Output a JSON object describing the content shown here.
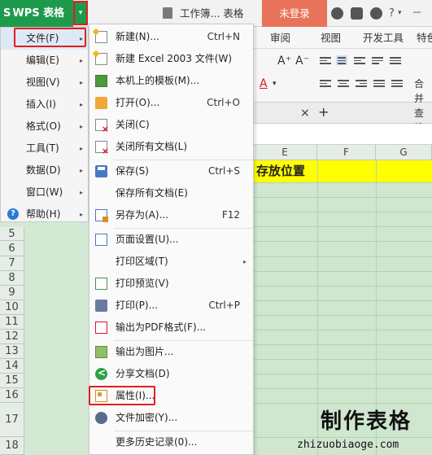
{
  "app": {
    "logo_text": "WPS 表格",
    "dropdown_glyph": "▾",
    "doc_title": "工作簿... 表格",
    "login_label": "未登录",
    "toolbar_glyphs": {
      "help": "?",
      "help_arrow": "▾",
      "minimize": "－"
    }
  },
  "ribbon": {
    "tabs": [
      "审阅",
      "视图",
      "开发工具",
      "特色"
    ],
    "font_grow": "A⁺",
    "font_shrink": "A⁻",
    "font_color_letter": "A",
    "font_color_arrow": "▾",
    "merge_label": "合并",
    "doc_tab_close": "×",
    "doc_tab_add": "+",
    "search_label": "查找"
  },
  "sheet": {
    "col_headers": [
      "E",
      "F",
      "G"
    ],
    "row_headers": [
      "5",
      "6",
      "7",
      "8",
      "9",
      "10",
      "11",
      "12",
      "13",
      "14",
      "15",
      "16",
      "17",
      "18"
    ],
    "yellow_cell_text": "存放位置"
  },
  "menu_level1": [
    {
      "label": "文件(F)",
      "arrow": "▸"
    },
    {
      "label": "编辑(E)",
      "arrow": "▸"
    },
    {
      "label": "视图(V)",
      "arrow": "▸"
    },
    {
      "label": "插入(I)",
      "arrow": "▸"
    },
    {
      "label": "格式(O)",
      "arrow": "▸"
    },
    {
      "label": "工具(T)",
      "arrow": "▸"
    },
    {
      "label": "数据(D)",
      "arrow": "▸"
    },
    {
      "label": "窗口(W)",
      "arrow": "▸"
    },
    {
      "label": "帮助(H)",
      "arrow": "▸",
      "icon_text": "?"
    }
  ],
  "menu_level2": [
    {
      "label": "新建(N)...",
      "shortcut": "Ctrl+N",
      "icon": "new-icon"
    },
    {
      "label": "新建 Excel 2003 文件(W)",
      "shortcut": "",
      "icon": "new-excel-icon"
    },
    {
      "label": "本机上的模板(M)...",
      "shortcut": "",
      "icon": "template-icon"
    },
    {
      "label": "打开(O)...",
      "shortcut": "Ctrl+O",
      "icon": "folder-open-icon"
    },
    {
      "label": "关闭(C)",
      "shortcut": "",
      "icon": "close-doc-icon"
    },
    {
      "label": "关闭所有文档(L)",
      "shortcut": "",
      "icon": "close-all-icon"
    },
    {
      "label": "保存(S)",
      "shortcut": "Ctrl+S",
      "icon": "save-icon"
    },
    {
      "label": "保存所有文档(E)",
      "shortcut": "",
      "icon": ""
    },
    {
      "label": "另存为(A)...",
      "shortcut": "F12",
      "icon": "save-as-icon"
    },
    {
      "label": "页面设置(U)...",
      "shortcut": "",
      "icon": "page-setup-icon"
    },
    {
      "label": "打印区域(T)",
      "shortcut": "",
      "icon": "",
      "submenu": "▸"
    },
    {
      "label": "打印预览(V)",
      "shortcut": "",
      "icon": "print-preview-icon"
    },
    {
      "label": "打印(P)...",
      "shortcut": "Ctrl+P",
      "icon": "printer-icon"
    },
    {
      "label": "输出为PDF格式(F)...",
      "shortcut": "",
      "icon": "pdf-icon"
    },
    {
      "label": "输出为图片...",
      "shortcut": "",
      "icon": "image-export-icon"
    },
    {
      "label": "分享文档(D)",
      "shortcut": "",
      "icon": "share-icon"
    },
    {
      "label": "属性(I)...",
      "shortcut": "",
      "icon": "properties-icon"
    },
    {
      "label": "文件加密(Y)...",
      "shortcut": "",
      "icon": "encrypt-icon"
    },
    {
      "label": "更多历史记录(0)...",
      "shortcut": "",
      "icon": ""
    }
  ],
  "watermark": {
    "title": "制作表格",
    "url": "zhizuobiaoge.com"
  }
}
